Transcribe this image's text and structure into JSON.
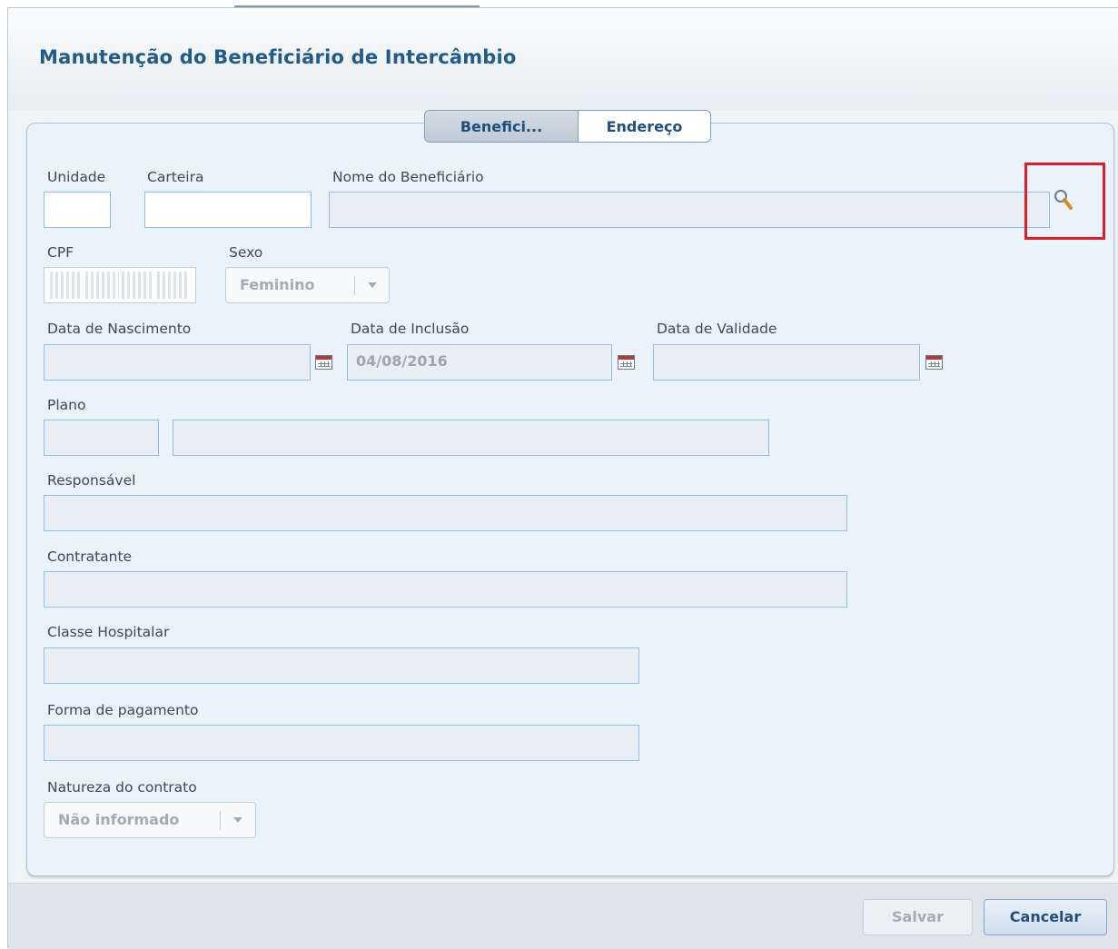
{
  "dialog": {
    "title": "Manutenção do Beneficiário de Intercâmbio"
  },
  "tabs": [
    {
      "label": "Benefici...",
      "active": true
    },
    {
      "label": "Endereço",
      "active": false
    }
  ],
  "form": {
    "unidade": {
      "label": "Unidade",
      "value": ""
    },
    "carteira": {
      "label": "Carteira",
      "value": ""
    },
    "nome_beneficiario": {
      "label": "Nome do Beneficiário",
      "value": ""
    },
    "cpf": {
      "label": "CPF",
      "value": ""
    },
    "sexo": {
      "label": "Sexo",
      "selected": "Feminino"
    },
    "data_nascimento": {
      "label": "Data de Nascimento",
      "value": ""
    },
    "data_inclusao": {
      "label": "Data de Inclusão",
      "value": "04/08/2016"
    },
    "data_validade": {
      "label": "Data de Validade",
      "value": ""
    },
    "plano": {
      "label": "Plano",
      "code": "",
      "description": ""
    },
    "responsavel": {
      "label": "Responsável",
      "value": ""
    },
    "contratante": {
      "label": "Contratante",
      "value": ""
    },
    "classe_hospitalar": {
      "label": "Classe Hospitalar",
      "value": ""
    },
    "forma_pagamento": {
      "label": "Forma de pagamento",
      "value": ""
    },
    "natureza_contrato": {
      "label": "Natureza do contrato",
      "selected": "Não informado"
    }
  },
  "footer": {
    "salvar_label": "Salvar",
    "cancelar_label": "Cancelar"
  },
  "icons": {
    "search": "magnifier-icon",
    "calendar": "calendar-icon",
    "dropdown": "chevron-down-icon"
  },
  "colors": {
    "title": "#1e5b8e",
    "panel_bg": "#eaf3fc",
    "field_border": "#8fc0ec",
    "highlight": "#e01e24"
  }
}
